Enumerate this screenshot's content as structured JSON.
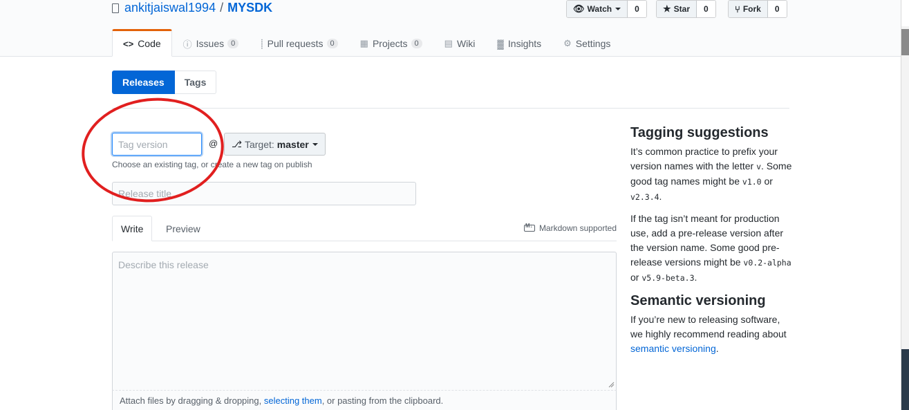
{
  "repo": {
    "owner": "ankitjaiswal1994",
    "separator": "/",
    "name": "MYSDK"
  },
  "actions": {
    "watch": {
      "label": "Watch",
      "count": "0"
    },
    "star": {
      "label": "Star",
      "count": "0"
    },
    "fork": {
      "label": "Fork",
      "count": "0"
    }
  },
  "nav": {
    "code": "Code",
    "issues": "Issues",
    "issues_count": "0",
    "pulls": "Pull requests",
    "pulls_count": "0",
    "projects": "Projects",
    "projects_count": "0",
    "wiki": "Wiki",
    "insights": "Insights",
    "settings": "Settings"
  },
  "subnav": {
    "releases": "Releases",
    "tags": "Tags"
  },
  "form": {
    "tag_placeholder": "Tag version",
    "at": "@",
    "target_label": "Target:",
    "target_value": "master",
    "hint": "Choose an existing tag, or create a new tag on publish",
    "title_placeholder": "Release title",
    "tab_write": "Write",
    "tab_preview": "Preview",
    "markdown": "Markdown supported",
    "body_placeholder": "Describe this release",
    "attach_prefix": "Attach files by dragging & dropping, ",
    "attach_link": "selecting them",
    "attach_suffix": ", or pasting from the clipboard."
  },
  "sidebar": {
    "tagging_title": "Tagging suggestions",
    "tagging_p1_a": "It’s common practice to prefix your version names with the letter ",
    "tagging_p1_code1": "v",
    "tagging_p1_b": ". Some good tag names might be ",
    "tagging_p1_code2": "v1.0",
    "tagging_p1_c": " or ",
    "tagging_p1_code3": "v2.3.4",
    "tagging_p1_d": ".",
    "tagging_p2_a": "If the tag isn’t meant for production use, add a pre-release version after the version name. Some good pre-release versions might be ",
    "tagging_p2_code1": "v0.2-alpha",
    "tagging_p2_b": " or ",
    "tagging_p2_code2": "v5.9-beta.3",
    "tagging_p2_c": ".",
    "semver_title": "Semantic versioning",
    "semver_p_a": "If you’re new to releasing software, we highly recommend reading about ",
    "semver_link": "semantic versioning",
    "semver_p_b": "."
  },
  "colors": {
    "accent": "#0366d6",
    "tab_highlight": "#e36209",
    "annotation": "#e11f1f"
  }
}
